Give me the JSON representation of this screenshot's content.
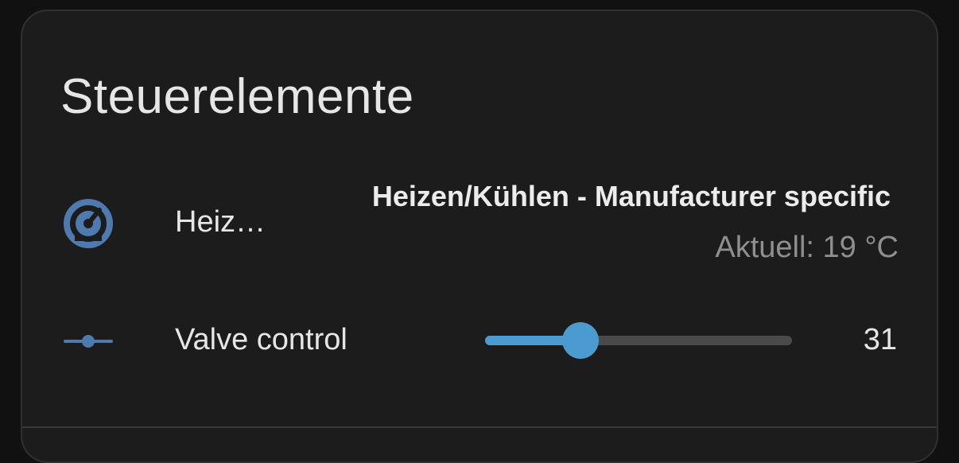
{
  "card": {
    "title": "Steuerelemente"
  },
  "rows": {
    "heating": {
      "icon": "thermostat-dial-icon",
      "icon_color": "#4f7ab0",
      "label": "Heiz…",
      "state": "Heizen/Kühlen - Manufacturer specific",
      "current": "Aktuell: 19 °C"
    },
    "valve": {
      "icon": "slider-icon",
      "icon_color": "#4f7ab0",
      "label": "Valve control",
      "value": "31",
      "slider_fraction": 0.31,
      "accent_color": "#4b9bd0"
    }
  }
}
